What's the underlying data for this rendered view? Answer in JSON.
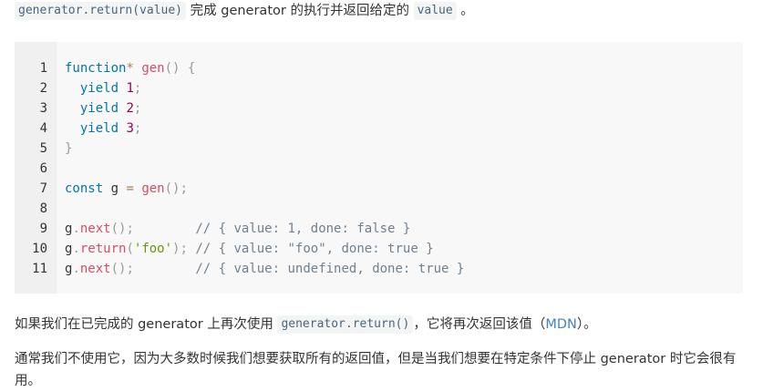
{
  "intro": {
    "code1": "generator.return(value)",
    "text1": " 完成 generator 的执行并返回给定的 ",
    "code2": "value",
    "text2": " 。"
  },
  "code": {
    "lines": [
      {
        "n": "1",
        "tokens": [
          [
            "kw",
            "function"
          ],
          [
            "op",
            "*"
          ],
          [
            "",
            " "
          ],
          [
            "fn",
            "gen"
          ],
          [
            "pn",
            "()"
          ],
          [
            "",
            " "
          ],
          [
            "pn",
            "{"
          ]
        ]
      },
      {
        "n": "2",
        "tokens": [
          [
            "",
            "  "
          ],
          [
            "kw",
            "yield"
          ],
          [
            "",
            " "
          ],
          [
            "num",
            "1"
          ],
          [
            "pn",
            ";"
          ]
        ]
      },
      {
        "n": "3",
        "tokens": [
          [
            "",
            "  "
          ],
          [
            "kw",
            "yield"
          ],
          [
            "",
            " "
          ],
          [
            "num",
            "2"
          ],
          [
            "pn",
            ";"
          ]
        ]
      },
      {
        "n": "4",
        "tokens": [
          [
            "",
            "  "
          ],
          [
            "kw",
            "yield"
          ],
          [
            "",
            " "
          ],
          [
            "num",
            "3"
          ],
          [
            "pn",
            ";"
          ]
        ]
      },
      {
        "n": "5",
        "tokens": [
          [
            "pn",
            "}"
          ]
        ]
      },
      {
        "n": "6",
        "tokens": []
      },
      {
        "n": "7",
        "tokens": [
          [
            "kw",
            "const"
          ],
          [
            "",
            " g "
          ],
          [
            "op",
            "="
          ],
          [
            "",
            " "
          ],
          [
            "fn",
            "gen"
          ],
          [
            "pn",
            "();"
          ]
        ]
      },
      {
        "n": "8",
        "tokens": []
      },
      {
        "n": "9",
        "tokens": [
          [
            "",
            "g"
          ],
          [
            "pn",
            "."
          ],
          [
            "fn",
            "next"
          ],
          [
            "pn",
            "();"
          ],
          [
            "",
            "        "
          ],
          [
            "cm",
            "// { value: 1, done: false }"
          ]
        ]
      },
      {
        "n": "10",
        "tokens": [
          [
            "",
            "g"
          ],
          [
            "pn",
            "."
          ],
          [
            "fn",
            "return"
          ],
          [
            "pn",
            "("
          ],
          [
            "str",
            "'foo'"
          ],
          [
            "pn",
            ");"
          ],
          [
            "",
            " "
          ],
          [
            "cm",
            "// { value: \"foo\", done: true }"
          ]
        ]
      },
      {
        "n": "11",
        "tokens": [
          [
            "",
            "g"
          ],
          [
            "pn",
            "."
          ],
          [
            "fn",
            "next"
          ],
          [
            "pn",
            "();"
          ],
          [
            "",
            "        "
          ],
          [
            "cm",
            "// { value: undefined, done: true }"
          ]
        ]
      }
    ]
  },
  "para1": {
    "text1": "如果我们在已完成的 generator 上再次使用 ",
    "code": "generator.return()",
    "text2": "，它将再次返回该值（",
    "link": "MDN",
    "text3": "）。"
  },
  "para2": {
    "text": "通常我们不使用它，因为大多数时候我们想要获取所有的返回值，但是当我们想要在特定条件下停止 generator 时它会很有用。"
  }
}
